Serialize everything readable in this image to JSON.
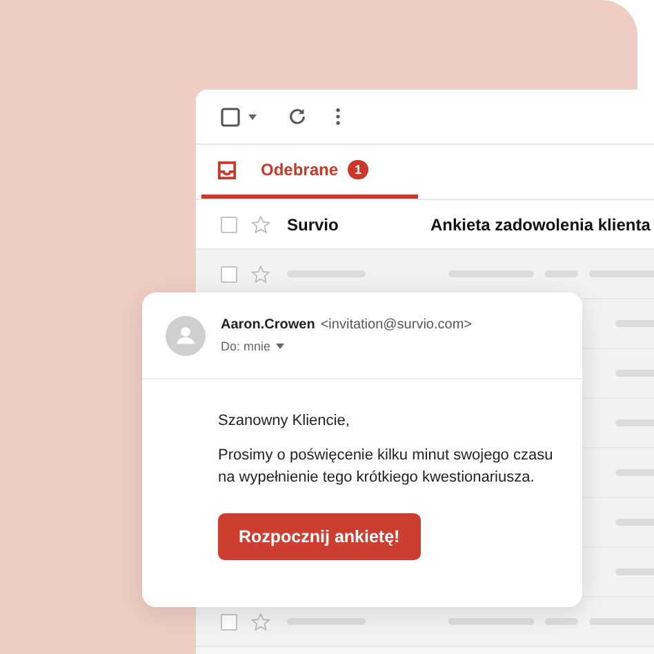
{
  "mail_window": {
    "tabs": [
      {
        "label": "Odebrane",
        "badge": "1",
        "selected": true
      }
    ],
    "rows": [
      {
        "kind": "message",
        "sender": "Survio",
        "subject": "Ankieta zadowolenia klienta",
        "checked": false,
        "starred": false,
        "unread": true
      },
      {
        "kind": "placeholder",
        "checked": false,
        "starred": false,
        "unread": false
      },
      {
        "kind": "covered"
      },
      {
        "kind": "covered"
      },
      {
        "kind": "covered"
      },
      {
        "kind": "covered"
      },
      {
        "kind": "covered"
      },
      {
        "kind": "covered"
      },
      {
        "kind": "placeholder",
        "checked": false,
        "starred": false,
        "unread": false
      }
    ]
  },
  "message_card": {
    "sender_name": "Aaron.Crowen",
    "sender_address": "<invitation@survio.com>",
    "recipient": "Do: mnie",
    "greeting": "Szanowny Kliencie,",
    "body": "Prosimy o poświęcenie kilku minut swojego czasu na wypełnienie tego krótkiego kwestionariusza.",
    "button": "Rozpocznij ankietę!"
  }
}
